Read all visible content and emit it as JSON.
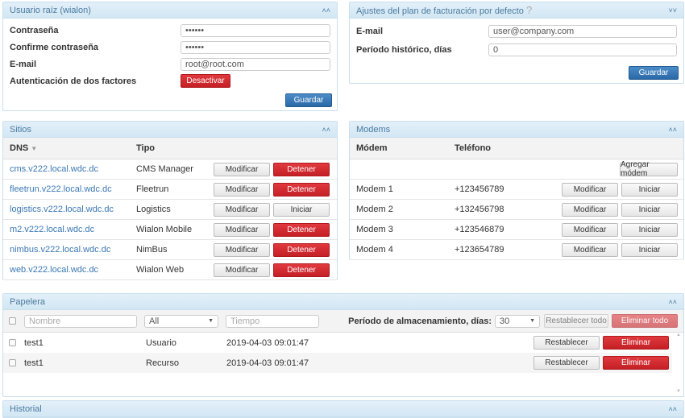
{
  "root": {
    "title": "Usuario raíz (wialon)",
    "password_label": "Contraseña",
    "password": "••••••",
    "confirm_label": "Confirme contraseña",
    "confirm": "••••••",
    "email_label": "E-mail",
    "email": "root@root.com",
    "twofa_label": "Autenticación de dos factores",
    "twofa_button": "Desactivar",
    "save": "Guardar"
  },
  "billing": {
    "title": "Ajustes del plan de facturación por defecto",
    "help": "?",
    "email_label": "E-mail",
    "email_placeholder": "user@company.com",
    "history_label": "Período histórico, días",
    "history": "0",
    "save": "Guardar"
  },
  "sites": {
    "title": "Sitios",
    "col_dns": "DNS",
    "col_type": "Tipo",
    "edit": "Modificar",
    "rows": [
      {
        "dns": "cms.v222.local.wdc.dc",
        "type": "CMS Manager",
        "action": "Detener",
        "red": true
      },
      {
        "dns": "fleetrun.v222.local.wdc.dc",
        "type": "Fleetrun",
        "action": "Detener",
        "red": true
      },
      {
        "dns": "logistics.v222.local.wdc.dc",
        "type": "Logistics",
        "action": "Iniciar",
        "red": false
      },
      {
        "dns": "m2.v222.local.wdc.dc",
        "type": "Wialon Mobile",
        "action": "Detener",
        "red": true
      },
      {
        "dns": "nimbus.v222.local.wdc.dc",
        "type": "NimBus",
        "action": "Detener",
        "red": true
      },
      {
        "dns": "web.v222.local.wdc.dc",
        "type": "Wialon Web",
        "action": "Detener",
        "red": true
      }
    ]
  },
  "modems": {
    "title": "Modems",
    "col_modem": "Módem",
    "col_phone": "Teléfono",
    "add": "Agregar módem",
    "edit": "Modificar",
    "start": "Iniciar",
    "rows": [
      {
        "name": "Modem 1",
        "phone": "+123456789"
      },
      {
        "name": "Modem 2",
        "phone": "+132456798"
      },
      {
        "name": "Modem 3",
        "phone": "+123546879"
      },
      {
        "name": "Modem 4",
        "phone": "+123654789"
      }
    ]
  },
  "trash": {
    "title": "Papelera",
    "name_placeholder": "Nombre",
    "type_filter": "All",
    "time_placeholder": "Tiempo",
    "period_label": "Período de almacenamiento, días:",
    "period": "30",
    "restore_all": "Restablecer todo",
    "delete_all": "Eliminar todo",
    "restore": "Restablecer",
    "delete": "Eliminar",
    "rows": [
      {
        "name": "test1",
        "type": "Usuario",
        "time": "2019-04-03 09:01:47"
      },
      {
        "name": "test1",
        "type": "Recurso",
        "time": "2019-04-03 09:01:47"
      }
    ]
  },
  "history": {
    "title": "Historial"
  }
}
